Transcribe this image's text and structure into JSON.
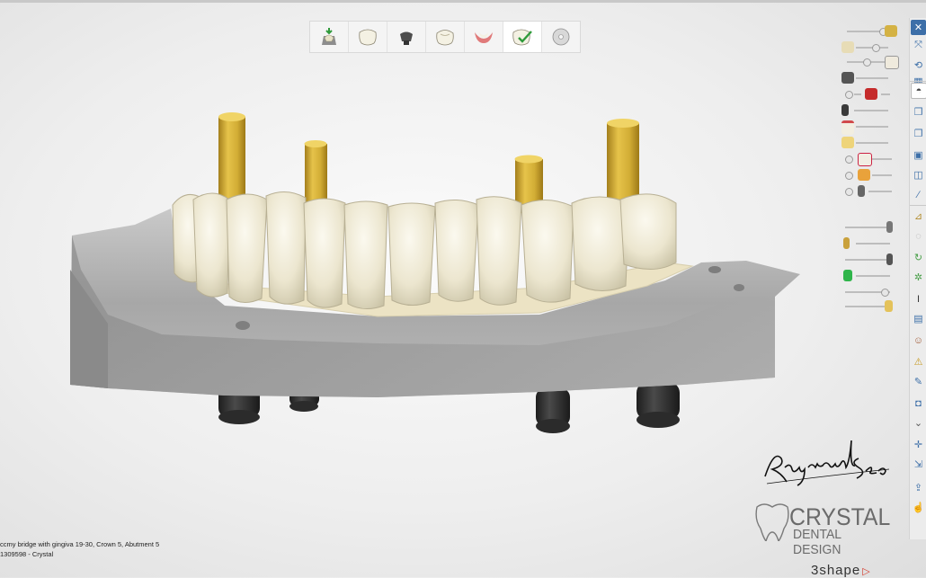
{
  "workflow": {
    "steps": [
      {
        "name": "model-step",
        "icon": "model-icon",
        "active": false
      },
      {
        "name": "crown-step",
        "icon": "tooth-crown-icon",
        "active": false
      },
      {
        "name": "abutment-step",
        "icon": "abutment-icon",
        "active": false
      },
      {
        "name": "anatomy-step",
        "icon": "tooth-anatomy-icon",
        "active": false
      },
      {
        "name": "gingiva-step",
        "icon": "gingiva-icon",
        "active": false
      },
      {
        "name": "check-step",
        "icon": "tooth-check-icon",
        "active": true
      },
      {
        "name": "export-step",
        "icon": "disc-icon",
        "active": false
      }
    ]
  },
  "status_bar": {
    "line1": "ccmy bridge with gingiva 19-30, Crown 5, Abutment 5",
    "line2": "1309598 - Crystal"
  },
  "logos": {
    "signature": "Raymond Seo",
    "company_line1": "CRYSTAL",
    "company_line2": "DENTAL DESIGN",
    "vendor": "3shape"
  },
  "colors": {
    "model_gray": "#b9b9b9",
    "teeth": "#efead6",
    "gingiva": "#ece3c4",
    "implant_post": "#d9b43c",
    "analog": "#3a3a3a",
    "tool_accent": "#3d6fa8",
    "vendor_triangle": "#d33a2c"
  }
}
